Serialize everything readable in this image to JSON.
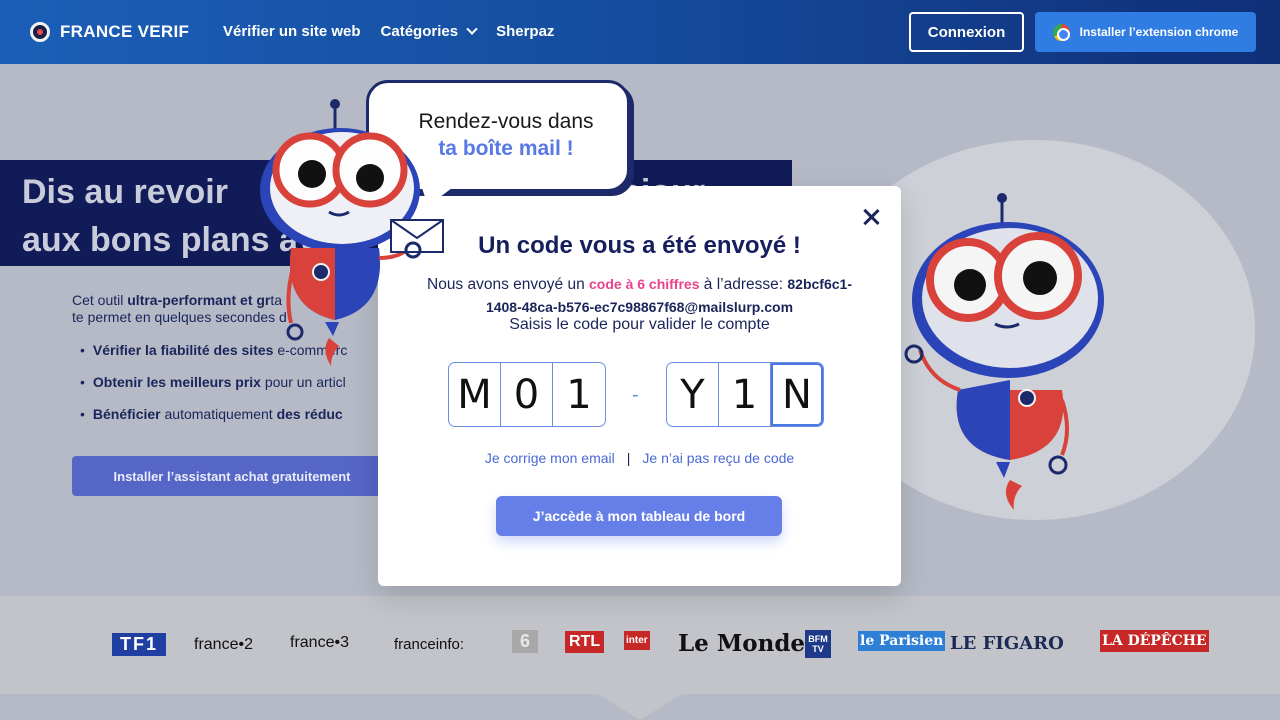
{
  "header": {
    "brand": "FRANCE VERIF",
    "nav": [
      {
        "label": "Vérifier un site web"
      },
      {
        "label": "Catégories",
        "has_dropdown": true
      },
      {
        "label": "Sherpaz"
      }
    ],
    "login_label": "Connexion",
    "extension_label": "Installer l’extension chrome"
  },
  "hero": {
    "title_line1": "Dis au revoir",
    "title_line1_tail": "eiour",
    "title_line2": "aux bons plans ave",
    "intro_prefix": "Cet outil ",
    "intro_bold": "ultra-performant et gr",
    "intro_suffix": "ta",
    "intro_line2": "te permet en quelques secondes d",
    "bullets": [
      {
        "bold": "Vérifier la fiabilité des sites",
        "text": " e-commerc"
      },
      {
        "bold": "Obtenir les meilleurs prix",
        "text": " pour un articl"
      },
      {
        "bold": "Bénéficier",
        "text": " automatiquement ",
        "bold2": "des réduc"
      }
    ],
    "install_button": "Installer l’assistant achat gratuitement"
  },
  "bubble": {
    "line1": "Rendez-vous dans",
    "line2": "ta boîte mail !"
  },
  "modal": {
    "title": "Un code vous a été envoyé !",
    "text_prefix": "Nous avons envoyé un ",
    "text_highlight": "code à 6 chiffres",
    "text_mid": " à l’adresse: ",
    "email_part1": "82bcf6c1-",
    "email_part2": "1408-48ca-b576-ec7c98867f68@mailslurp.com",
    "subtitle": "Saisis le code pour valider le compte",
    "code_first": [
      "M",
      "0",
      "1"
    ],
    "code_separator": "-",
    "code_second": [
      "Y",
      "1",
      "N"
    ],
    "link_fix_email": "Je corrige mon email",
    "link_separator": "|",
    "link_no_code": "Je n’ai pas reçu de code",
    "cta_label": "J’accède à mon tableau de bord"
  },
  "media_logos": [
    "TF1",
    "france•2",
    "france•3",
    "franceinfo:",
    "6",
    "RTL",
    "inter",
    "Le Monde",
    "BFM TV",
    "le Parisien",
    "LE FIGARO",
    "LA DÉPÊCHE"
  ],
  "colors": {
    "header_start": "#1b5fb8",
    "header_end": "#0f2f78",
    "navy": "#161f5e",
    "accent_pink": "#e8428d",
    "accent_blue": "#667fe8"
  }
}
